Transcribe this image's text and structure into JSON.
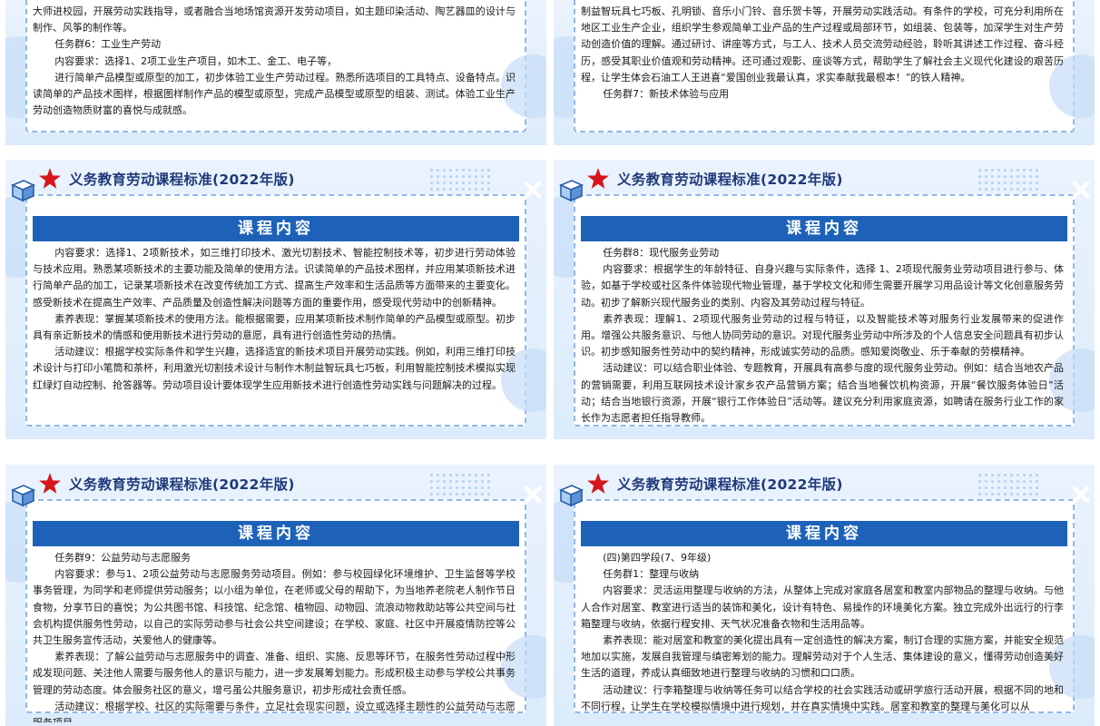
{
  "header_text": "义务教育劳动课程标准(2022年版)",
  "banner_text": "课程内容",
  "colors": {
    "accent": "#1d62b8",
    "heading": "#1f3a7a",
    "star": "#d7161b"
  },
  "icons": [
    "star-icon",
    "cube-icon",
    "x-icon"
  ],
  "slides": [
    {
      "paragraphs": [
        {
          "indent": false,
          "text": "大师进校园，开展劳动实践指导，或者融合当地场馆资源开发劳动项目，如主题印染活动、陶艺器皿的设计与制作、风筝的制作等。"
        },
        {
          "indent": true,
          "text": "任务群6：工业生产劳动"
        },
        {
          "indent": true,
          "text": "内容要求：选择1、2项工业生产项目，如木工、金工、电子等，"
        },
        {
          "indent": true,
          "text": "进行简单产品模型或原型的加工，初步体验工业生产劳动过程。熟悉所选项目的工具特点、设备特点。识读简单的产品技术图样，根据图样制作产品的模型或原型，完成产品模型或原型的组装、测试。体验工业生产劳动创造物质财富的喜悦与成就感。"
        }
      ]
    },
    {
      "paragraphs": [
        {
          "indent": false,
          "text": "制益智玩具七巧板、孔明锁、音乐小门铃、音乐贺卡等，开展劳动实践活动。有条件的学校，可充分利用所在地区工业生产企业，组织学生参观简单工业产品的生产过程或局部环节，如组装、包装等，加深学生对生产劳动创造价值的理解。通过研讨、讲座等方式，与工人、技术人员交流劳动经验，聆听其讲述工作过程、奋斗经历，感受其职业价值观和劳动精神。还可通过观影、座谈等方式，帮助学生了解社会主义现代化建设的艰苦历程，让学生体会石油工人王进喜“爱国创业我最认真，求实奉献我最根本！”的铁人精神。"
        },
        {
          "indent": true,
          "text": "任务群7：新技术体验与应用"
        }
      ]
    },
    {
      "paragraphs": [
        {
          "indent": true,
          "text": "内容要求：选择1、2项新技术，如三维打印技术、激光切割技术、智能控制技术等，初步进行劳动体验与技术应用。熟悉某项新技术的主要功能及简单的使用方法。识读简单的产品技术图样，并应用某项新技术进行简单产品的加工，记录某项新技术在改变传统加工方式、提高生产效率和生活品质等方面带来的主要变化。感受新技术在提高生产效率、产品质量及创造性解决问题等方面的重要作用，感受现代劳动中的创新精神。"
        },
        {
          "indent": true,
          "text": "素养表现：掌握某项新技术的使用方法。能根据需要，应用某项新技术制作简单的产品模型或原型。初步具有亲近新技术的情感和使用新技术进行劳动的意愿，具有进行创造性劳动的热情。"
        },
        {
          "indent": true,
          "text": "活动建议：根据学校实际条件和学生兴趣，选择适宜的新技术项目开展劳动实践。例如，利用三维打印技术设计与打印小笔筒和茶杯，利用激光切割技术设计与制作木制益智玩具七巧板，利用智能控制技术模拟实现红绿灯自动控制、抢答器等。劳动项目设计要体现学生应用新技术进行创造性劳动实践与问题解决的过程。"
        }
      ]
    },
    {
      "paragraphs": [
        {
          "indent": true,
          "text": "任务群8：现代服务业劳动"
        },
        {
          "indent": true,
          "text": "内容要求：根据学生的年龄特征、自身兴趣与实际条件，选择 1、2项现代服务业劳动项目进行参与、体验，如基于学校或社区条件体验现代物业管理，基于学校文化和师生需要开展学习用品设计等文化创意服务劳动。初步了解新兴现代服务业的类别、内容及其劳动过程与特征。"
        },
        {
          "indent": true,
          "text": "素养表现：理解1、2项现代服务业劳动的过程与特征，以及智能技术等对服务行业发展带来的促进作用。增强公共服务意识、与他人协同劳动的意识。对现代服务业劳动中所涉及的个人信息安全问题具有初步认识。初步感知服务性劳动中的契约精神，形成诚实劳动的品质。感知爱岗敬业、乐于奉献的劳模精神。"
        },
        {
          "indent": true,
          "text": "活动建议：可以结合职业体验、专题教育，开展具有高参与度的现代服务业劳动。例如：结合当地农产品的营销需要，利用互联网技术设计家乡农产品营销方案；结合当地餐饮机构资源，开展“餐饮服务体验日”活动；结合当地银行资源，开展“银行工作体验日”活动等。建议充分利用家庭资源，如聘请在服务行业工作的家长作为志愿者担任指导教师。"
        }
      ]
    },
    {
      "paragraphs": [
        {
          "indent": true,
          "text": "任务群9：公益劳动与志愿服务"
        },
        {
          "indent": true,
          "text": "内容要求：参与1、2项公益劳动与志愿服务劳动项目。例如：参与校园绿化环境维护、卫生监督等学校事务管理，为同学和老师提供劳动服务；以小组为单位，在老师或父母的帮助下，为当地养老院老人制作节日食物，分享节日的喜悦；为公共图书馆、科技馆、纪念馆、植物园、动物园、流浪动物救助站等公共空间与社会机构提供服务性劳动，以自己的实际劳动参与社会公共空间建设；在学校、家庭、社区中开展疫情防控等公共卫生服务宣传活动，关爱他人的健康等。"
        },
        {
          "indent": true,
          "text": "素养表现：了解公益劳动与志愿服务中的调查、准备、组织、实施、反思等环节，在服务性劳动过程中形成发现问题、关注他人需要与服务他人的意识与能力，进一步发展筹划能力。形成积极主动参与学校公共事务管理的劳动态度。体会服务社区的意义，增弓虽公共服务意识，初步形成社会责任感。"
        },
        {
          "indent": true,
          "text": "活动建议：根据学校、社区的实际需要与条件，立足社会现实问题，设立或选择主题性的公益劳动与志愿服务项目。"
        }
      ]
    },
    {
      "paragraphs": [
        {
          "indent": true,
          "text": "(四)第四学段(7、9年级)"
        },
        {
          "indent": true,
          "text": "任务群1：整理与收纳"
        },
        {
          "indent": true,
          "text": "内容要求：灵活运用整理与收纳的方法，从整体上完成对家庭各居室和教室内部物品的整理与收纳。与他人合作对居室、教室进行适当的装饰和美化，设计有特色、易操作的环境美化方案。独立完成外出远行的行李箱整理与收纳，依据行程安排、天气状况准备衣物和生活用品等。"
        },
        {
          "indent": true,
          "text": "素养表现：能对居室和教室的美化提出具有一定创造性的解决方案，制订合理的实施方案，并能安全规范地加以实施，发展自我管理与缜密筹划的能力。理解劳动对于个人生活、集体建设的意义，懂得劳动创造美好生活的道理，养成认真细致地进行整理与收纳的习惯和口口质。"
        },
        {
          "indent": true,
          "text": "活动建议：行李箱整理与收纳等任务可以结合学校的社会实践活动或研学旅行活动开展，根据不同的地和不同行程，让学生在学校模拟情境中进行规划，并在真实情境中实践。居室和教室的整理与美化可以从"
        }
      ]
    }
  ]
}
